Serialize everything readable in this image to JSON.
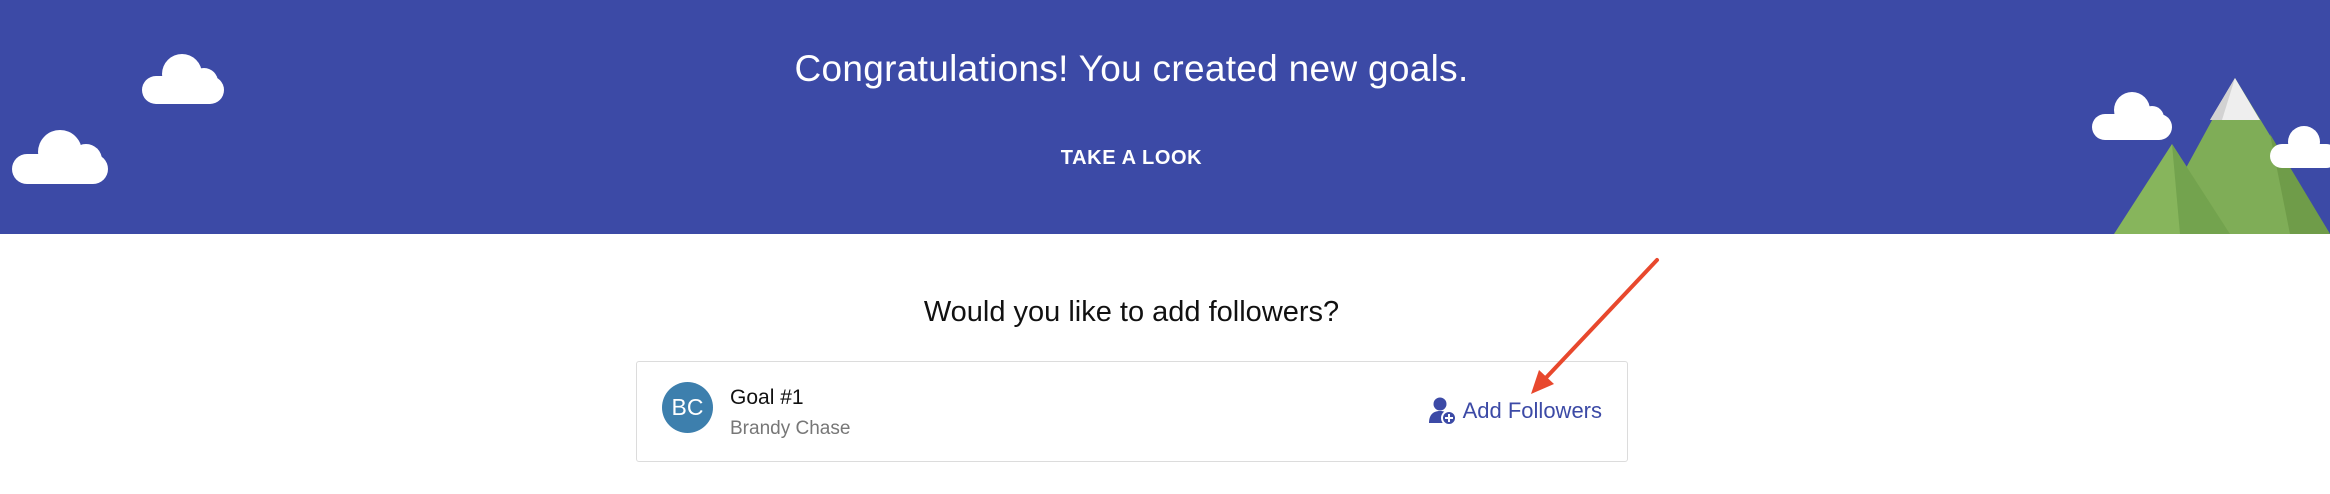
{
  "banner": {
    "title": "Congratulations! You created new goals.",
    "cta_label": "TAKE A LOOK",
    "background_color": "#3c4aa6"
  },
  "followers_prompt": {
    "question": "Would you like to add followers?"
  },
  "goal": {
    "avatar_initials": "BC",
    "avatar_color": "#3d7fad",
    "title": "Goal #1",
    "owner": "Brandy Chase",
    "action_label": "Add Followers",
    "action_icon": "add-user-icon"
  },
  "annotation": {
    "arrow_color": "#e8482d"
  }
}
